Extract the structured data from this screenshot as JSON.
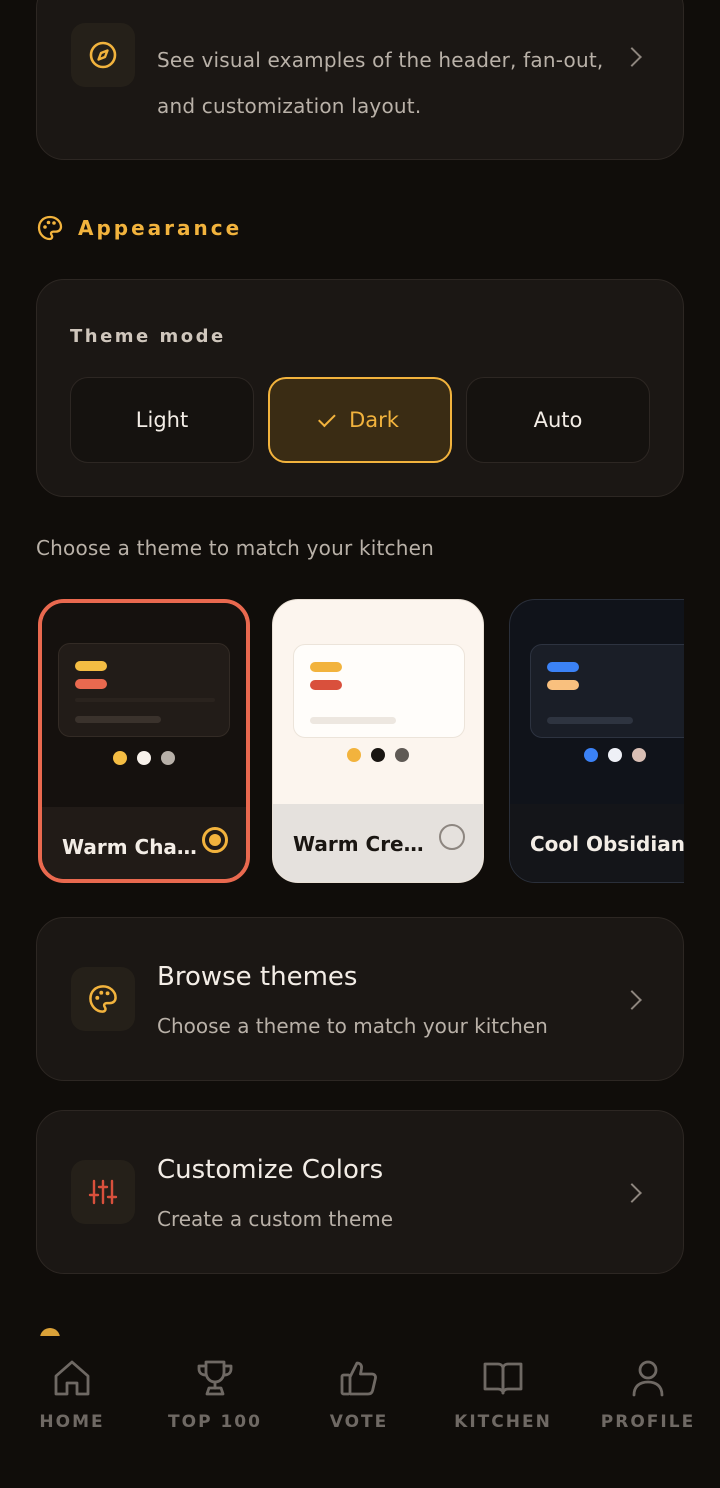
{
  "top_card": {
    "description": "See visual examples of the header, fan-out, and customization layout.",
    "icon": "compass-icon"
  },
  "appearance": {
    "section_label": "Appearance",
    "icon": "palette-icon",
    "theme_mode": {
      "title": "Theme mode",
      "options": [
        "Light",
        "Dark",
        "Auto"
      ],
      "selected": "Dark"
    }
  },
  "themes": {
    "hint": "Choose a theme to match your kitchen",
    "cards": [
      {
        "name": "Warm Charc…",
        "selected": true,
        "colors": [
          "#f4bd43",
          "#e9694f",
          "#f7f1ea",
          "#b7b0a8"
        ]
      },
      {
        "name": "Warm Cream",
        "selected": false,
        "colors": [
          "#f2b33d",
          "#d9503c",
          "#1a1612",
          "#5f5a55"
        ]
      },
      {
        "name": "Cool Obsidian",
        "selected": false,
        "colors": [
          "#3b82f6",
          "#f9c07e",
          "#eef0f6",
          "#d9bfb5"
        ]
      }
    ]
  },
  "list": [
    {
      "title": "Browse themes",
      "subtitle": "Choose a theme to match your kitchen",
      "icon": "palette-icon"
    },
    {
      "title": "Customize Colors",
      "subtitle": "Create a custom theme",
      "icon": "sliders-icon"
    }
  ],
  "nav": {
    "items": [
      {
        "label": "HOME",
        "icon": "home-icon"
      },
      {
        "label": "TOP 100",
        "icon": "trophy-icon"
      },
      {
        "label": "VOTE",
        "icon": "thumbs-up-icon"
      },
      {
        "label": "KITCHEN",
        "icon": "book-icon"
      },
      {
        "label": "PROFILE",
        "icon": "user-icon"
      }
    ]
  },
  "colors": {
    "accent": "#f2b33d",
    "background": "#100d0a",
    "card": "#1b1714",
    "selected_border": "#e9694f"
  }
}
